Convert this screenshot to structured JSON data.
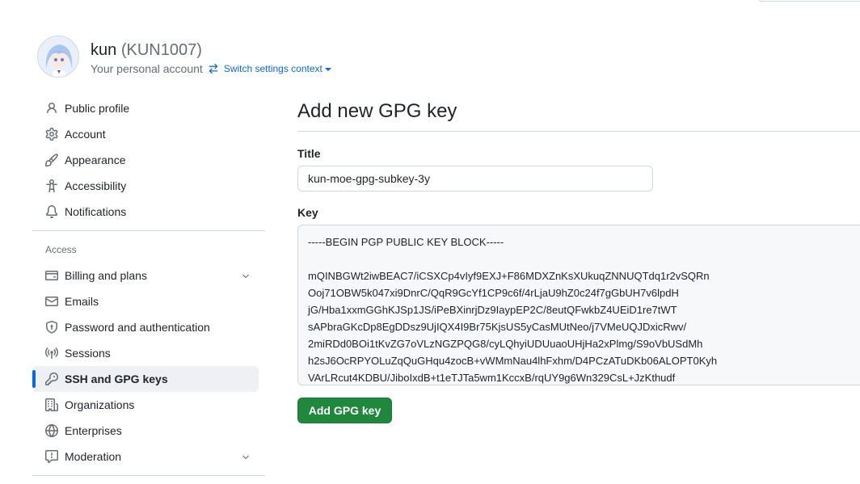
{
  "header": {
    "name": "kun",
    "login": "(KUN1007)",
    "subtitle": "Your personal account",
    "switch_context": "Switch settings context"
  },
  "sidebar": {
    "items_top": [
      {
        "label": "Public profile",
        "icon": "person-icon"
      },
      {
        "label": "Account",
        "icon": "gear-icon"
      },
      {
        "label": "Appearance",
        "icon": "paintbrush-icon"
      },
      {
        "label": "Accessibility",
        "icon": "accessibility-icon"
      },
      {
        "label": "Notifications",
        "icon": "bell-icon"
      }
    ],
    "access_label": "Access",
    "items_access": [
      {
        "label": "Billing and plans",
        "icon": "credit-card-icon"
      },
      {
        "label": "Emails",
        "icon": "mail-icon"
      },
      {
        "label": "Password and authentication",
        "icon": "shield-lock-icon"
      },
      {
        "label": "Sessions",
        "icon": "broadcast-icon"
      },
      {
        "label": "SSH and GPG keys",
        "icon": "key-icon"
      },
      {
        "label": "Organizations",
        "icon": "organization-icon"
      },
      {
        "label": "Enterprises",
        "icon": "globe-icon"
      },
      {
        "label": "Moderation",
        "icon": "report-icon"
      }
    ]
  },
  "main": {
    "title": "Add new GPG key",
    "title_field_label": "Title",
    "title_field_value": "kun-moe-gpg-subkey-3y",
    "key_field_label": "Key",
    "key_lines": [
      "-----BEGIN PGP PUBLIC KEY BLOCK-----",
      "",
      "mQINBGWt2iwBEAC7/iCSXCp4vIyf9EXJ+F86MDXZnKsXUkuqZNNUQTdq1r2vSQRn",
      "Ooj71OBW5k047xi9DnrC/QqR9GcYf1CP9c6f/4rLjaU9hZ0c24f7gGbUH7v6lpdH",
      "jG/Hba1xxmGGhKJSp1JS/iPeBXinrjDz9IaypEP2C/8eutQFwkbZ4UEiD1re7tWT",
      "sAPbraGKcDp8EgDDsz9UjIQX4I9Br75KjsUS5yCasMUtNeo/j7VMeUQJDxicRwv/",
      "2miRDd0BOi1tKvZG7oVLzNGZPQG8/cyLQhyiUDUuaoUHjHa2xPlmg/S9oVbUSdMh",
      "h2sJ6OcRPYOLuZqQuGHqu4zocB+vWMmNau4lhFxhm/D4PCzATuDKb06ALOPT0Kyh",
      "VArLRcut4KDBU/JiboIxdB+t1eTJTa5wm1KccxB/rqUY9g6Wn329CsL+JzKthudf"
    ],
    "submit_label": "Add GPG key"
  }
}
